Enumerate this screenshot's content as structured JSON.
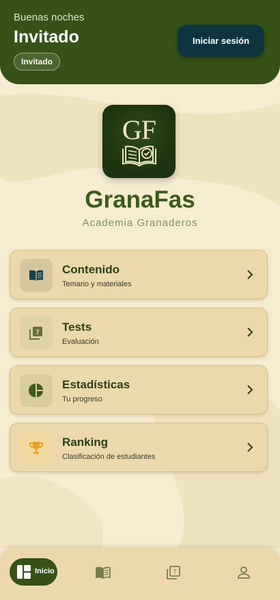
{
  "header": {
    "greeting": "Buenas noches",
    "user_name": "Invitado",
    "user_chip": "Invitado",
    "login_label": "Iniciar sesión"
  },
  "brand": {
    "logo_text": "GF",
    "name": "GranaFas",
    "subtitle": "Academia Granaderos"
  },
  "menu": [
    {
      "title": "Contenido",
      "subtitle": "Temario y materiales",
      "icon": "book-icon"
    },
    {
      "title": "Tests",
      "subtitle": "Evaluación",
      "icon": "quiz-icon"
    },
    {
      "title": "Estadísticas",
      "subtitle": "Tu progreso",
      "icon": "pie-chart-icon"
    },
    {
      "title": "Ranking",
      "subtitle": "Clasificación de estudiantes",
      "icon": "trophy-icon"
    }
  ],
  "bottom_nav": {
    "home_label": "Inicio",
    "items": [
      "home-icon",
      "book-icon",
      "quiz-icon",
      "person-icon"
    ]
  },
  "colors": {
    "primary": "#365218",
    "background": "#f6ecd2",
    "card": "#ecd8ac",
    "login_button": "#0f3440",
    "accent_trophy": "#e8a020"
  }
}
